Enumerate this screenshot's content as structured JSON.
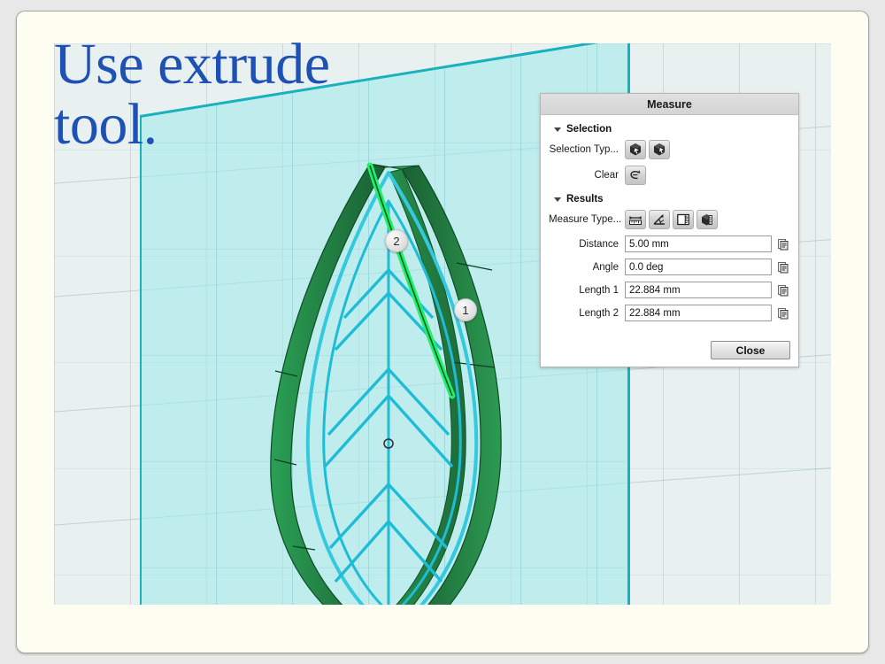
{
  "slide": {
    "title": "Use extrude tool.",
    "title_color": "#1f51b5",
    "background_color": "#fdfdf1"
  },
  "cad_view": {
    "background_color": "#e9f1f0",
    "sketch_plane_color": "#a0ebeb",
    "plane_edge_color": "#18b1bd",
    "sketch_line_color": "#1fbcd6",
    "solid_fill_light": "#2e9e52",
    "solid_fill_dark": "#1c6b37",
    "highlight_edge_color": "#23f06a",
    "markers": [
      {
        "label": "2",
        "name": "measure-marker-2"
      },
      {
        "label": "1",
        "name": "measure-marker-1"
      }
    ]
  },
  "dialog": {
    "title": "Measure",
    "selection": {
      "header": "Selection",
      "selection_type_label": "Selection Typ...",
      "selection_type_buttons": [
        "select-solid-icon",
        "select-face-icon"
      ],
      "clear_label": "Clear",
      "clear_icon": "undo-arrow-icon"
    },
    "results": {
      "header": "Results",
      "measure_type_label": "Measure Type...",
      "measure_type_buttons": [
        "distance-ruler-icon",
        "angle-measure-icon",
        "length-measure-icon",
        "volume-measure-icon"
      ],
      "fields": [
        {
          "label": "Distance",
          "value": "5.00 mm",
          "copy_icon": "copy-icon"
        },
        {
          "label": "Angle",
          "value": "0.0 deg",
          "copy_icon": "copy-icon"
        },
        {
          "label": "Length 1",
          "value": "22.884 mm",
          "copy_icon": "copy-icon"
        },
        {
          "label": "Length 2",
          "value": "22.884 mm",
          "copy_icon": "copy-icon"
        }
      ]
    },
    "close_label": "Close"
  }
}
